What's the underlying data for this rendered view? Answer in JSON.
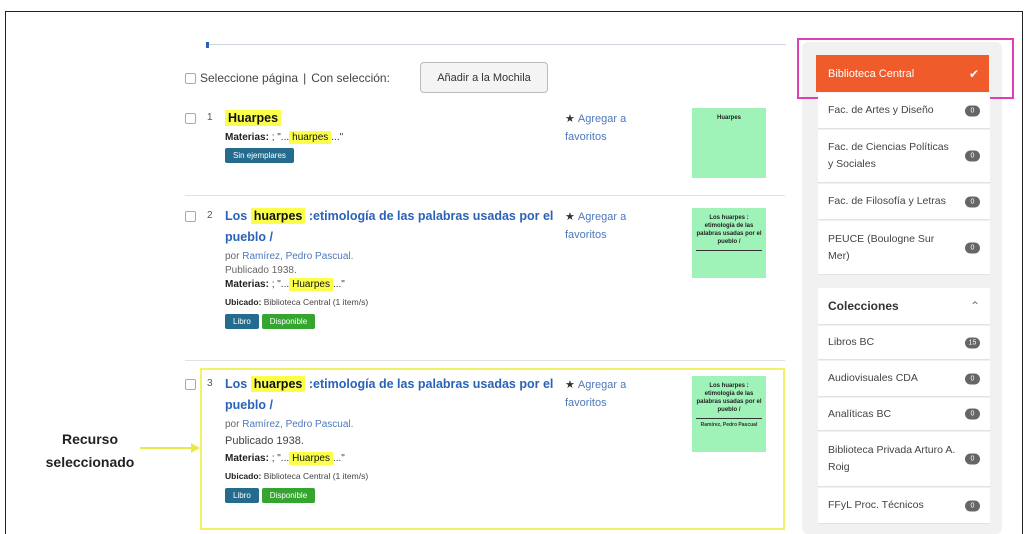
{
  "toolbar": {
    "select_page": "Seleccione página",
    "separator": "|",
    "with_selection": "Con selección:",
    "mochila_button": "Añadir a la Mochila"
  },
  "results": [
    {
      "number": "1",
      "title_highlight": "Huarpes",
      "materias_label": "Materias:",
      "materias_prefix": "; \"...",
      "materias_highlight": "huarpes",
      "materias_suffix": "...\"",
      "badges": [
        "Sin ejemplares"
      ],
      "favorite": "Agregar a favoritos",
      "cover_title": "Huarpes"
    },
    {
      "number": "2",
      "title_prefix": "Los",
      "title_highlight": "huarpes",
      "title_suffix": ":etimología de las palabras usadas por el pueblo /",
      "by_label": "por",
      "author": "Ramírez, Pedro Pascual.",
      "published": "Publicado 1938.",
      "materias_label": "Materias:",
      "materias_prefix": "; \"...",
      "materias_highlight": "Huarpes",
      "materias_suffix": "...\"",
      "ubicado_label": "Ubicado:",
      "ubicado_value": "Biblioteca Central (1 item/s)",
      "badges": [
        "Libro",
        "Disponible"
      ],
      "favorite": "Agregar a favoritos",
      "cover_title": "Los huarpes : etimología de las palabras usadas por el pueblo /"
    },
    {
      "number": "3",
      "title_prefix": "Los",
      "title_highlight": "huarpes",
      "title_suffix": ":etimología de las palabras usadas por el pueblo /",
      "by_label": "por",
      "author": "Ramírez, Pedro Pascual.",
      "published": "Publicado 1938.",
      "materias_label": "Materias:",
      "materias_prefix": "; \"...",
      "materias_highlight": "Huarpes",
      "materias_suffix": "...\"",
      "ubicado_label": "Ubicado:",
      "ubicado_value": "Biblioteca Central (1 item/s)",
      "badges": [
        "Libro",
        "Disponible"
      ],
      "favorite": "Agregar a favoritos",
      "cover_title": "Los huarpes : etimología de las palabras usadas por el pueblo /",
      "cover_author": "Ramírez, Pedro Pascual"
    }
  ],
  "annotation": "Recurso seleccionado",
  "sidebar": {
    "active_library": "Biblioteca Central",
    "libraries": [
      {
        "label": "Fac. de Artes y Diseño",
        "count": "0"
      },
      {
        "label": "Fac. de Ciencias Políticas y Sociales",
        "count": "0"
      },
      {
        "label": "Fac. de Filosofía y Letras",
        "count": "0"
      },
      {
        "label": "PEUCE (Boulogne Sur Mer)",
        "count": "0"
      }
    ],
    "collections_heading": "Colecciones",
    "collections": [
      {
        "label": "Libros BC",
        "count": "15"
      },
      {
        "label": "Audiovisuales CDA",
        "count": "0"
      },
      {
        "label": "Analíticas BC",
        "count": "0"
      },
      {
        "label": "Biblioteca Privada Arturo A. Roig",
        "count": "0"
      },
      {
        "label": "FFyL Proc. Técnicos",
        "count": "0"
      }
    ]
  },
  "colors": {
    "accent": "#ef5b2a",
    "link": "#2a62b8",
    "highlight": "#fbff49",
    "badge_blue": "#256b8e",
    "badge_green": "#35a530",
    "cover": "#9ff2b8",
    "pink_callout": "#de3fb3",
    "yellow_callout": "#f1f264"
  }
}
